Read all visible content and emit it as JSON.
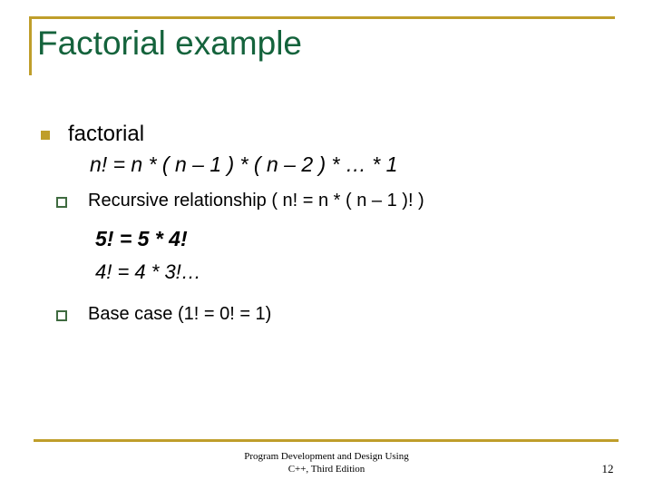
{
  "slide": {
    "title": "Factorial example",
    "accent_gold": "#bf9e2b",
    "title_green": "#14633c",
    "body_black": "#000000",
    "sub_marker_green": "#3f6b40",
    "background": "#ffffff"
  },
  "body": {
    "items": [
      {
        "level": 1,
        "marker": "filled-gold-square",
        "text": "factorial"
      },
      {
        "level": "equation",
        "style": "formula",
        "text": "n! = n * ( n – 1 ) * ( n – 2 ) * … * 1"
      },
      {
        "level": 2,
        "marker": "hollow-green-square",
        "text": "Recursive relationship ( n! = n * ( n – 1 )! )"
      },
      {
        "level": "equation",
        "style": "strong",
        "text": "5! = 5 * 4!"
      },
      {
        "level": "equation",
        "style": "light",
        "text": "4! = 4 * 3!…"
      },
      {
        "level": 2,
        "marker": "hollow-green-square",
        "text": "Base case (1! = 0! = 1)"
      }
    ]
  },
  "footer": {
    "line1": "Program Development and Design Using",
    "line2": "C++, Third Edition",
    "page_number": "12"
  }
}
